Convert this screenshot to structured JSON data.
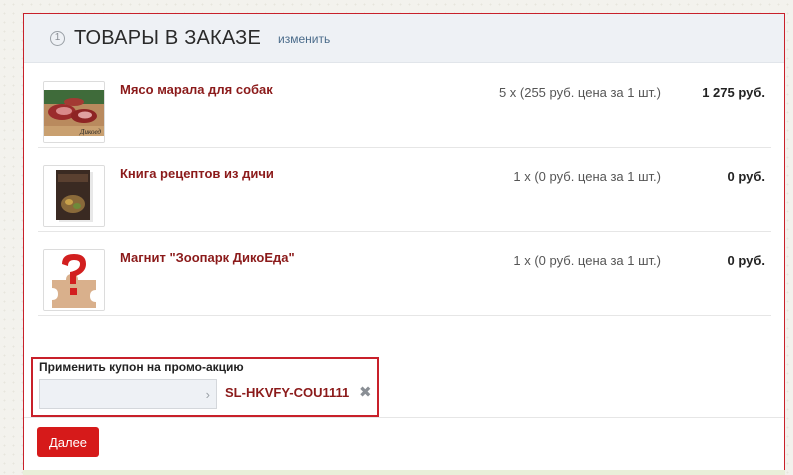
{
  "header": {
    "step_number": "1",
    "title": "ТОВАРЫ В ЗАКАЗЕ",
    "edit_label": "изменить"
  },
  "items": [
    {
      "name": "Мясо марала для собак",
      "quantity_text": "5 x (255 руб. цена за 1 шт.)",
      "sum": "1 275 руб.",
      "image_logo_text": "Дикоед"
    },
    {
      "name": "Книга рецептов из дичи",
      "quantity_text": "1 x (0 руб. цена за 1 шт.)",
      "sum": "0 руб."
    },
    {
      "name": "Магнит \"Зоопарк ДикоЕда\"",
      "quantity_text": "1 x (0 руб. цена за 1 шт.)",
      "sum": "0 руб."
    }
  ],
  "coupon": {
    "label": "Применить купон на промо-акцию",
    "input_value": "",
    "applied_code": "SL-HKVFY-COU1111"
  },
  "actions": {
    "next_label": "Далее"
  },
  "colors": {
    "accent": "#c8202a",
    "item_link": "#8b1a1a",
    "header_bg": "#eef1f5"
  }
}
